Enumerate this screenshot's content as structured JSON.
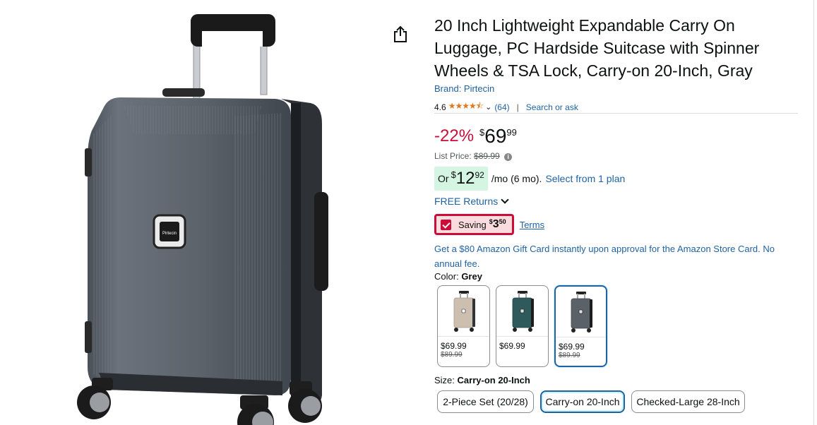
{
  "product": {
    "title": "20 Inch Lightweight Expandable Carry On Luggage, PC Hardside Suitcase with Spinner Wheels & TSA Lock, Carry-on 20-Inch, Gray",
    "brand_link": "Brand: Pirtecin",
    "image_logo": "Pirtecin"
  },
  "rating": {
    "value": "4.6",
    "stars_glyph": "★★★★⯪",
    "count": "(64)",
    "separator": "|",
    "search_link": "Search or ask"
  },
  "price": {
    "discount": "-22%",
    "symbol": "$",
    "whole": "69",
    "fraction": "99",
    "list_label": "List Price:",
    "list_value": "$89.99"
  },
  "monthly": {
    "or_label": "Or",
    "symbol": "$",
    "whole": "12",
    "fraction": "92",
    "term": "/mo (6 mo).",
    "select_link": "Select from 1 plan"
  },
  "returns": {
    "label": "FREE Returns"
  },
  "coupon": {
    "label": "Saving",
    "symbol": "$",
    "whole": "3",
    "fraction": "50",
    "terms_link": "Terms",
    "checked": true
  },
  "gift_card": {
    "text": "Get a $80 Amazon Gift Card instantly upon approval for the Amazon Store Card. No annual fee."
  },
  "color": {
    "label": "Color:",
    "selected": "Grey",
    "options": [
      {
        "name": "Beige",
        "price": "$69.99",
        "list": "$89.99",
        "color": "#cdbfb0"
      },
      {
        "name": "Teal",
        "price": "$69.99",
        "list": "",
        "color": "#2e5a5c"
      },
      {
        "name": "Grey",
        "price": "$69.99",
        "list": "$89.99",
        "color": "#5b6169"
      }
    ]
  },
  "size": {
    "label": "Size:",
    "selected": "Carry-on 20-Inch",
    "options": [
      "2-Piece Set (20/28)",
      "Carry-on 20-Inch",
      "Checked-Large 28-Inch"
    ]
  },
  "colors": {
    "link": "#2162a1",
    "deal_red": "#cc0c39",
    "star": "#de7921",
    "monthly_bg": "#d5f5e3",
    "suitcase": "#5b6169"
  }
}
